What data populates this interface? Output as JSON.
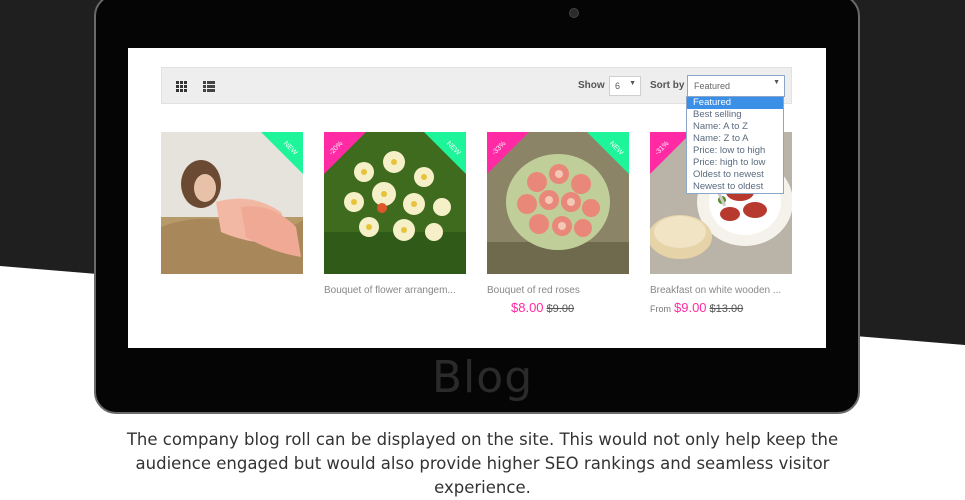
{
  "toolbar": {
    "show_label": "Show",
    "show_value": "6",
    "sort_label": "Sort by",
    "sort_value": "Featured"
  },
  "sort_options": [
    "Featured",
    "Best selling",
    "Name: A to Z",
    "Name: Z to A",
    "Price: low to high",
    "Price: high to low",
    "Oldest to newest",
    "Newest to oldest"
  ],
  "products": [
    {
      "name": "",
      "badge_new": "NEW"
    },
    {
      "name": "Bouquet of flower arrangem...",
      "badge_sale": "-20%",
      "badge_new": "NEW"
    },
    {
      "name": "Bouquet of red roses",
      "badge_sale": "-33%",
      "badge_new": "NEW",
      "price": "$8.00",
      "old_price": "$9.00"
    },
    {
      "name": "Breakfast on white wooden ...",
      "badge_sale": "-31%",
      "price_prefix": "From",
      "price": "$9.00",
      "old_price": "$13.00"
    }
  ],
  "section": {
    "title": "Blog",
    "description": "The company blog roll can be displayed on the site. This would not only help keep the audience engaged but would also provide higher SEO rankings and seamless visitor experience."
  },
  "colors": {
    "accent_pink": "#ff2aa4",
    "accent_green": "#1ef59a",
    "select_blue": "#3b8fe6"
  }
}
